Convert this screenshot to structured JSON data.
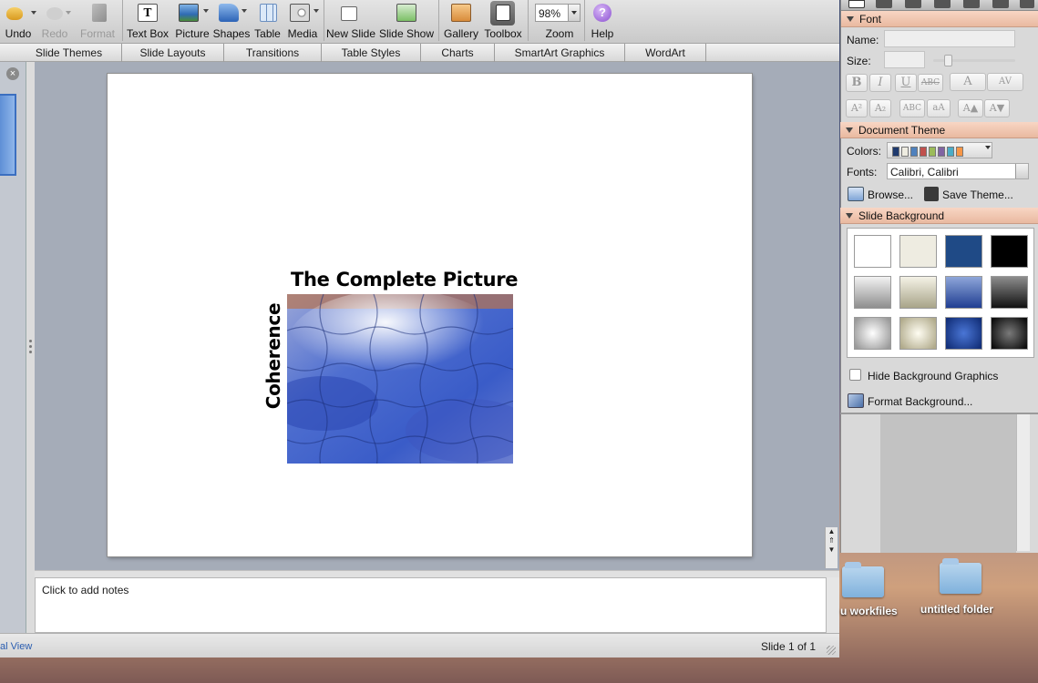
{
  "toolbar": {
    "undo": "Undo",
    "redo": "Redo",
    "format": "Format",
    "text_box": "Text Box",
    "picture": "Picture",
    "shapes": "Shapes",
    "table": "Table",
    "media": "Media",
    "new_slide": "New Slide",
    "slide_show": "Slide Show",
    "gallery": "Gallery",
    "toolbox": "Toolbox",
    "zoom_value": "98%",
    "zoom": "Zoom",
    "help": "Help"
  },
  "ribbon_tabs": [
    "Slide Themes",
    "Slide Layouts",
    "Transitions",
    "Table Styles",
    "Charts",
    "SmartArt Graphics",
    "WordArt"
  ],
  "slide": {
    "title": "The Complete Picture",
    "side_label": "Coherence"
  },
  "notes": {
    "placeholder": "Click to add notes"
  },
  "status": {
    "view": "al View",
    "slide_count": "Slide 1 of 1"
  },
  "toolbox": {
    "font": {
      "header": "Font",
      "name_label": "Name:",
      "size_label": "Size:",
      "buttons": [
        "B",
        "I",
        "U",
        "ABC",
        "A",
        "AV",
        "A²",
        "A₂",
        "ABC",
        "aA",
        "A▲",
        "A▼"
      ]
    },
    "document_theme": {
      "header": "Document Theme",
      "colors_label": "Colors:",
      "fonts_label": "Fonts:",
      "fonts_value": "Calibri, Calibri",
      "browse": "Browse...",
      "save_theme": "Save Theme...",
      "swatches": [
        "#1f3a6e",
        "#eeece1",
        "#4f81bd",
        "#c0504d",
        "#9bbb59",
        "#8064a2",
        "#4bacc6",
        "#f79646"
      ]
    },
    "slide_background": {
      "header": "Slide Background",
      "hide_graphics": "Hide Background Graphics",
      "format_background": "Format Background..."
    }
  },
  "desktop": {
    "folder1": "u workfiles",
    "folder2": "untitled folder"
  }
}
